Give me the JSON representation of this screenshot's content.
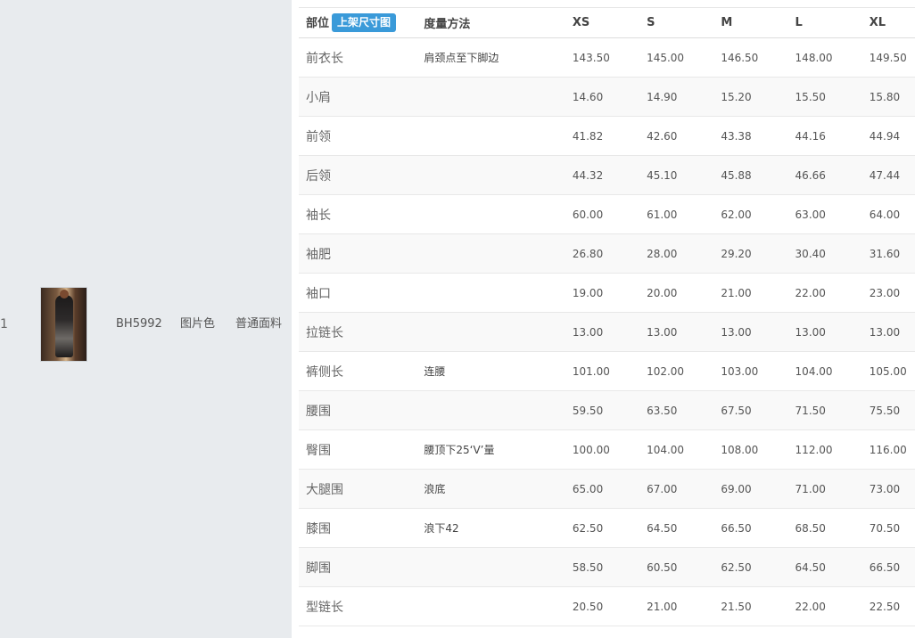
{
  "product": {
    "index": "1",
    "sku": "BH5992",
    "color": "图片色",
    "fabric": "普通面料",
    "image_icon": "product-photo"
  },
  "size_table": {
    "headers": {
      "part": "部位",
      "upload_button": "上架尺寸图",
      "method": "度量方法",
      "sizes": [
        "XS",
        "S",
        "M",
        "L",
        "XL"
      ]
    },
    "rows": [
      {
        "part": "前衣长",
        "method": "肩颈点至下脚边",
        "values": [
          "143.50",
          "145.00",
          "146.50",
          "148.00",
          "149.50"
        ]
      },
      {
        "part": "小肩",
        "method": "",
        "values": [
          "14.60",
          "14.90",
          "15.20",
          "15.50",
          "15.80"
        ]
      },
      {
        "part": "前领",
        "method": "",
        "values": [
          "41.82",
          "42.60",
          "43.38",
          "44.16",
          "44.94"
        ]
      },
      {
        "part": "后领",
        "method": "",
        "values": [
          "44.32",
          "45.10",
          "45.88",
          "46.66",
          "47.44"
        ]
      },
      {
        "part": "袖长",
        "method": "",
        "values": [
          "60.00",
          "61.00",
          "62.00",
          "63.00",
          "64.00"
        ]
      },
      {
        "part": "袖肥",
        "method": "",
        "values": [
          "26.80",
          "28.00",
          "29.20",
          "30.40",
          "31.60"
        ]
      },
      {
        "part": "袖口",
        "method": "",
        "values": [
          "19.00",
          "20.00",
          "21.00",
          "22.00",
          "23.00"
        ]
      },
      {
        "part": "拉链长",
        "method": "",
        "values": [
          "13.00",
          "13.00",
          "13.00",
          "13.00",
          "13.00"
        ]
      },
      {
        "part": "裤侧长",
        "method": "连腰",
        "values": [
          "101.00",
          "102.00",
          "103.00",
          "104.00",
          "105.00"
        ]
      },
      {
        "part": "腰围",
        "method": "",
        "values": [
          "59.50",
          "63.50",
          "67.50",
          "71.50",
          "75.50"
        ]
      },
      {
        "part": "臀围",
        "method": "腰顶下25‘V’量",
        "values": [
          "100.00",
          "104.00",
          "108.00",
          "112.00",
          "116.00"
        ]
      },
      {
        "part": "大腿围",
        "method": "浪底",
        "values": [
          "65.00",
          "67.00",
          "69.00",
          "71.00",
          "73.00"
        ]
      },
      {
        "part": "膝围",
        "method": "浪下42",
        "values": [
          "62.50",
          "64.50",
          "66.50",
          "68.50",
          "70.50"
        ]
      },
      {
        "part": "脚围",
        "method": "",
        "values": [
          "58.50",
          "60.50",
          "62.50",
          "64.50",
          "66.50"
        ]
      },
      {
        "part": "型链长",
        "method": "",
        "values": [
          "20.50",
          "21.00",
          "21.50",
          "22.00",
          "22.50"
        ]
      }
    ]
  },
  "colors": {
    "left_panel_bg": "#e8ebee",
    "badge_bg": "#3a9ad9",
    "row_alt_bg": "#f9f9f9"
  }
}
